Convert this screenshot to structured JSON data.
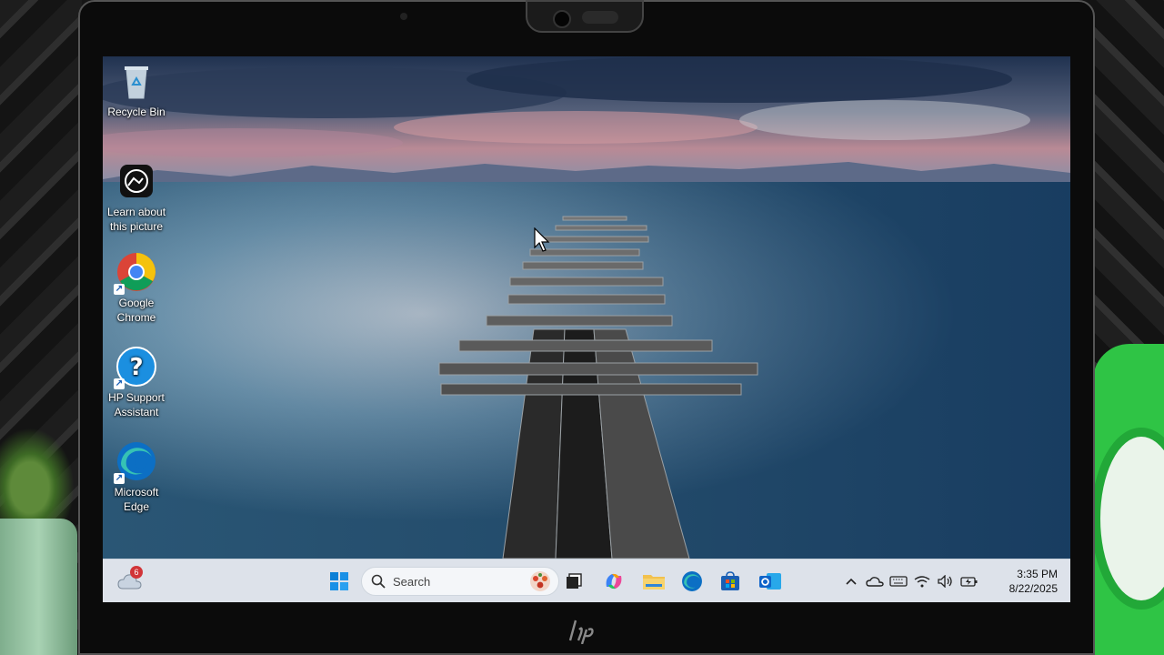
{
  "desktop": {
    "icons": [
      {
        "label": "Recycle Bin",
        "icon": "recycle-bin-icon"
      },
      {
        "label": "Learn about this picture",
        "icon": "camera-icon"
      },
      {
        "label": "Google Chrome",
        "icon": "chrome-icon"
      },
      {
        "label": "HP Support Assistant",
        "icon": "question-mark-icon"
      },
      {
        "label": "Microsoft Edge",
        "icon": "edge-icon"
      }
    ]
  },
  "taskbar": {
    "weather_badge": "6",
    "search_placeholder": "Search",
    "pinned": [
      {
        "icon": "start-icon"
      },
      {
        "icon": "task-view-icon"
      },
      {
        "icon": "copilot-icon"
      },
      {
        "icon": "file-explorer-icon"
      },
      {
        "icon": "edge-icon"
      },
      {
        "icon": "microsoft-store-icon"
      },
      {
        "icon": "outlook-icon"
      }
    ],
    "tray": [
      "chevron-up-icon",
      "onedrive-icon",
      "keyboard-icon",
      "wifi-icon",
      "volume-icon",
      "battery-icon"
    ],
    "time": "3:35 PM",
    "date": "8/22/2025"
  },
  "colors": {
    "taskbar": "#e4e9f0",
    "sky_top": "#2c3e60",
    "sea": "#3b6f92",
    "windows_blue": "#0a7fd6",
    "badge_red": "#d13438"
  }
}
